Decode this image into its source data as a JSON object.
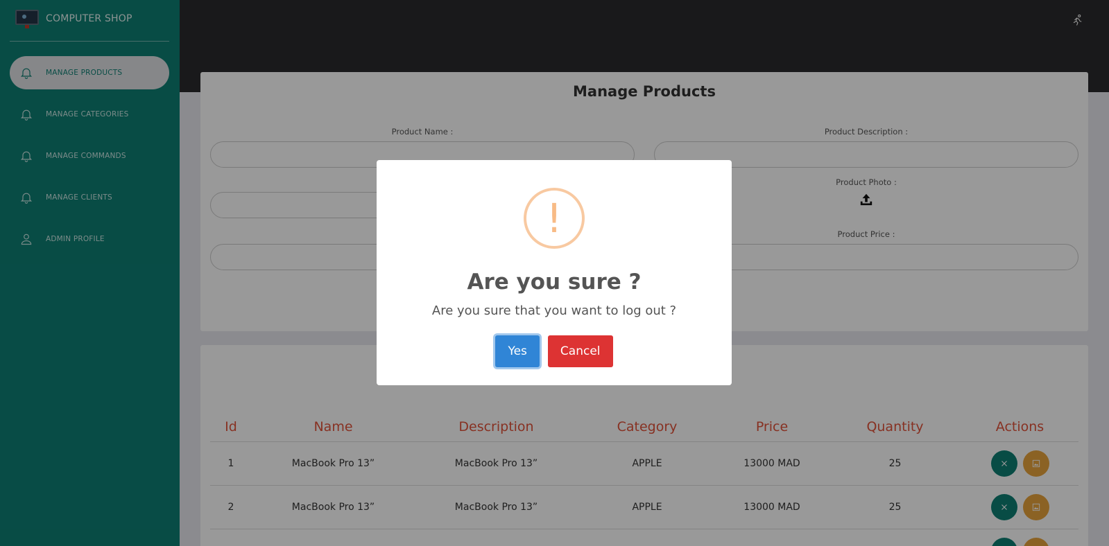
{
  "brand": {
    "name": "COMPUTER SHOP"
  },
  "sidebar": {
    "items": [
      {
        "label": "MANAGE PRODUCTS",
        "icon": "bell-icon",
        "active": true
      },
      {
        "label": "MANAGE CATEGORIES",
        "icon": "bell-icon",
        "active": false
      },
      {
        "label": "MANAGE COMMANDS",
        "icon": "bell-icon",
        "active": false
      },
      {
        "label": "MANAGE CLIENTS",
        "icon": "bell-icon",
        "active": false
      },
      {
        "label": "ADMIN PROFILE",
        "icon": "user-icon",
        "active": false
      }
    ]
  },
  "topbar": {
    "logout_icon": "running-person-icon"
  },
  "form": {
    "title": "Manage Products",
    "product_name_label": "Product Name :",
    "product_description_label": "Product Description :",
    "product_photo_label": "Product Photo :",
    "product_price_label": "Product Price :"
  },
  "table": {
    "headers": [
      "Id",
      "Name",
      "Description",
      "Category",
      "Price",
      "Quantity",
      "Actions"
    ],
    "rows": [
      {
        "id": "1",
        "name": "MacBook Pro 13”",
        "description": "MacBook Pro 13”",
        "category": "APPLE",
        "price": "13000 MAD",
        "quantity": "25"
      },
      {
        "id": "2",
        "name": "MacBook Pro 13”",
        "description": "MacBook Pro 13”",
        "category": "APPLE",
        "price": "13000 MAD",
        "quantity": "25"
      }
    ]
  },
  "modal": {
    "icon": "!",
    "title": "Are you sure ?",
    "text": "Are you sure that you want to log out ?",
    "yes_label": "Yes",
    "cancel_label": "Cancel"
  },
  "colors": {
    "sidebar": "#0e7f74",
    "topbar": "#2a2a2d",
    "table_header": "#e2523a",
    "confirm": "#3085d6",
    "cancel": "#dd3333",
    "warning": "#f8bb86",
    "image_action": "#e8a33c"
  }
}
